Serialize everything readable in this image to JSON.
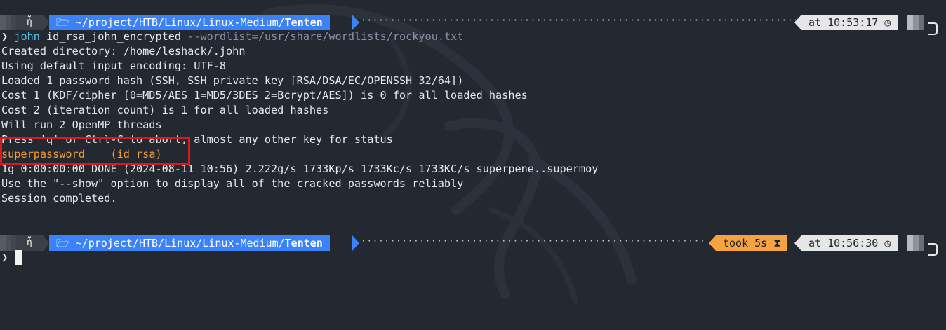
{
  "prompt1": {
    "os_icon": "ἧ",
    "folder_icon": "🗁",
    "path": "~/project/HTB/Linux/Linux-Medium/",
    "dir": "Tenten",
    "time": "at 10:53:17 ◷"
  },
  "command": {
    "prompt_char": "❯",
    "program": "john",
    "file": "id_rsa_john_encrypted",
    "option": "--wordlist=/usr/share/wordlists/rockyou.txt"
  },
  "output": [
    "Created directory: /home/leshack/.john",
    "Using default input encoding: UTF-8",
    "Loaded 1 password hash (SSH, SSH private key [RSA/DSA/EC/OPENSSH 32/64])",
    "Cost 1 (KDF/cipher [0=MD5/AES 1=MD5/3DES 2=Bcrypt/AES]) is 0 for all loaded hashes",
    "Cost 2 (iteration count) is 1 for all loaded hashes",
    "Will run 2 OpenMP threads",
    "Press 'q' or Ctrl-C to abort, almost any other key for status"
  ],
  "cracked": {
    "password": "superpassword",
    "file": "(id_rsa)"
  },
  "output2": [
    "1g 0:00:00:00 DONE (2024-08-11 10:56) 2.222g/s 1733Kp/s 1733Kc/s 1733KC/s superpene..supermoy",
    "Use the \"--show\" option to display all of the cracked passwords reliably",
    "Session completed."
  ],
  "prompt2": {
    "os_icon": "ἧ",
    "folder_icon": "🗁",
    "path": "~/project/HTB/Linux/Linux-Medium/",
    "dir": "Tenten",
    "took": "took 5s ⧗",
    "time": "at 10:56:30 ◷",
    "prompt_char": "❯"
  },
  "colors": {
    "background": "#232831",
    "path_segment": "#3b82f6",
    "took_segment": "#f4a340",
    "highlight_box": "#d81a1a",
    "cracked_text": "#f49b3a"
  }
}
